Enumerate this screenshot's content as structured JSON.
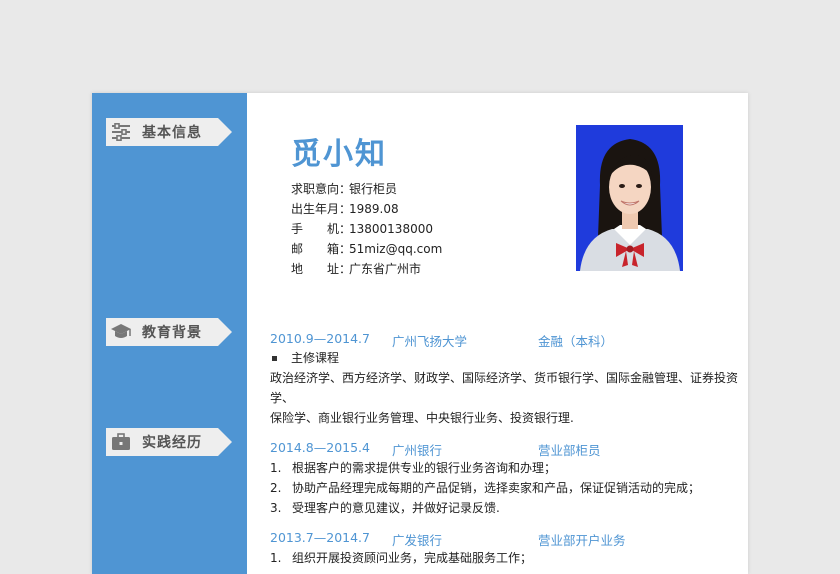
{
  "sections": {
    "basic": "基本信息",
    "education": "教育背景",
    "practice": "实践经历"
  },
  "name": "觅小知",
  "info": [
    {
      "label": "求职意向：",
      "value": "银行柜员"
    },
    {
      "label": "出生年月：",
      "value": "1989.08"
    },
    {
      "label": "手　　机：",
      "value": "13800138000"
    },
    {
      "label": "邮　　箱：",
      "value": "51miz@qq.com"
    },
    {
      "label": "地　　址：",
      "value": "广东省广州市"
    }
  ],
  "education": {
    "period": "2010.9—2014.7",
    "school": "广州飞扬大学",
    "major": "金融（本科）",
    "course_title": "主修课程",
    "course_line1": "政治经济学、西方经济学、财政学、国际经济学、货币银行学、国际金融管理、证券投资学、",
    "course_line2": "保险学、商业银行业务管理、中央银行业务、投资银行理."
  },
  "jobs": [
    {
      "period": "2014.8—2015.4",
      "company": "广州银行",
      "role": "营业部柜员",
      "duties": [
        {
          "num": "1.",
          "text": "根据客户的需求提供专业的银行业务咨询和办理；"
        },
        {
          "num": "2.",
          "text": "协助产品经理完成每期的产品促销，选择卖家和产品，保证促销活动的完成；"
        },
        {
          "num": "3.",
          "text": "受理客户的意见建议，并做好记录反馈."
        }
      ]
    },
    {
      "period": "2013.7—2014.7",
      "company": "广发银行",
      "role": "营业部开户业务",
      "duties": [
        {
          "num": "1.",
          "text": "组织开展投资顾问业务，完成基础服务工作；"
        }
      ]
    }
  ]
}
